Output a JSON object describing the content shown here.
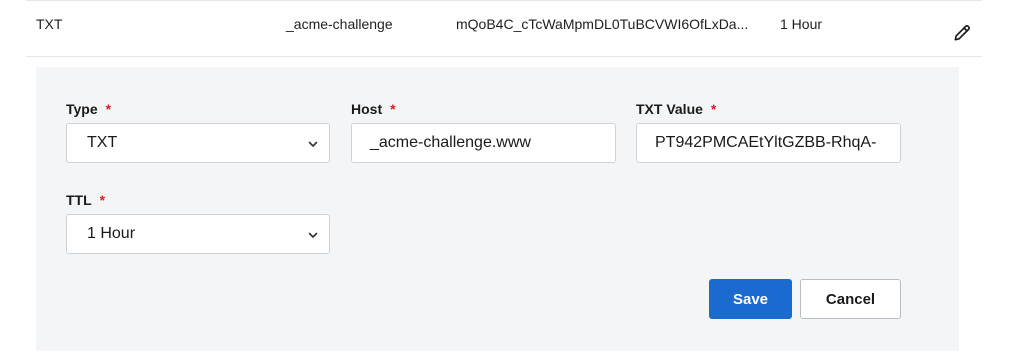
{
  "record": {
    "type": "TXT",
    "host": "_acme-challenge",
    "value": "mQoB4C_cTcWaMpmDL0TuBCVWI6OfLxDa...",
    "ttl": "1 Hour",
    "edit_icon": "pencil-icon"
  },
  "form": {
    "type_field": {
      "label": "Type",
      "required_mark": "*",
      "value": "TXT",
      "icon": "chevron-down-icon"
    },
    "host_field": {
      "label": "Host",
      "required_mark": "*",
      "value": "_acme-challenge.www"
    },
    "txt_value_field": {
      "label": "TXT Value",
      "required_mark": "*",
      "value": "PT942PMCAEtYltGZBB-RhqA-"
    },
    "ttl_field": {
      "label": "TTL",
      "required_mark": "*",
      "value": "1 Hour",
      "icon": "chevron-down-icon"
    },
    "save_label": "Save",
    "cancel_label": "Cancel"
  },
  "colors": {
    "primary": "#1b6ad0",
    "required": "#d6202a",
    "panel_bg": "#f4f5f7"
  }
}
